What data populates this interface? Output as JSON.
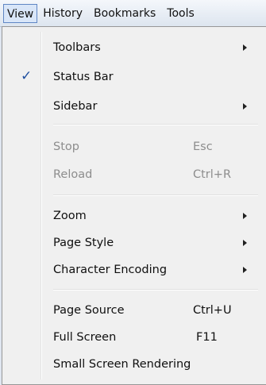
{
  "menubar": {
    "items": [
      {
        "label": "View",
        "active": true
      },
      {
        "label": "History",
        "active": false
      },
      {
        "label": "Bookmarks",
        "active": false
      },
      {
        "label": "Tools",
        "active": false
      }
    ]
  },
  "menu": {
    "toolbars": {
      "label": "Toolbars"
    },
    "status_bar": {
      "label": "Status Bar",
      "checked": true,
      "check_glyph": "✓"
    },
    "sidebar": {
      "label": "Sidebar"
    },
    "stop": {
      "label": "Stop",
      "shortcut": "Esc",
      "disabled": true
    },
    "reload": {
      "label": "Reload",
      "shortcut": "Ctrl+R",
      "disabled": true
    },
    "zoom": {
      "label": "Zoom"
    },
    "page_style": {
      "label": "Page Style"
    },
    "character_encoding": {
      "label": "Character Encoding"
    },
    "page_source": {
      "label": "Page Source",
      "shortcut": "Ctrl+U"
    },
    "full_screen": {
      "label": "Full Screen",
      "shortcut": "F11"
    },
    "small_screen_rendering": {
      "label": "Small Screen Rendering"
    }
  },
  "colors": {
    "accent_border": "#5f86c4",
    "check_color": "#1f4f9f",
    "disabled_text": "#8d8d8d"
  }
}
